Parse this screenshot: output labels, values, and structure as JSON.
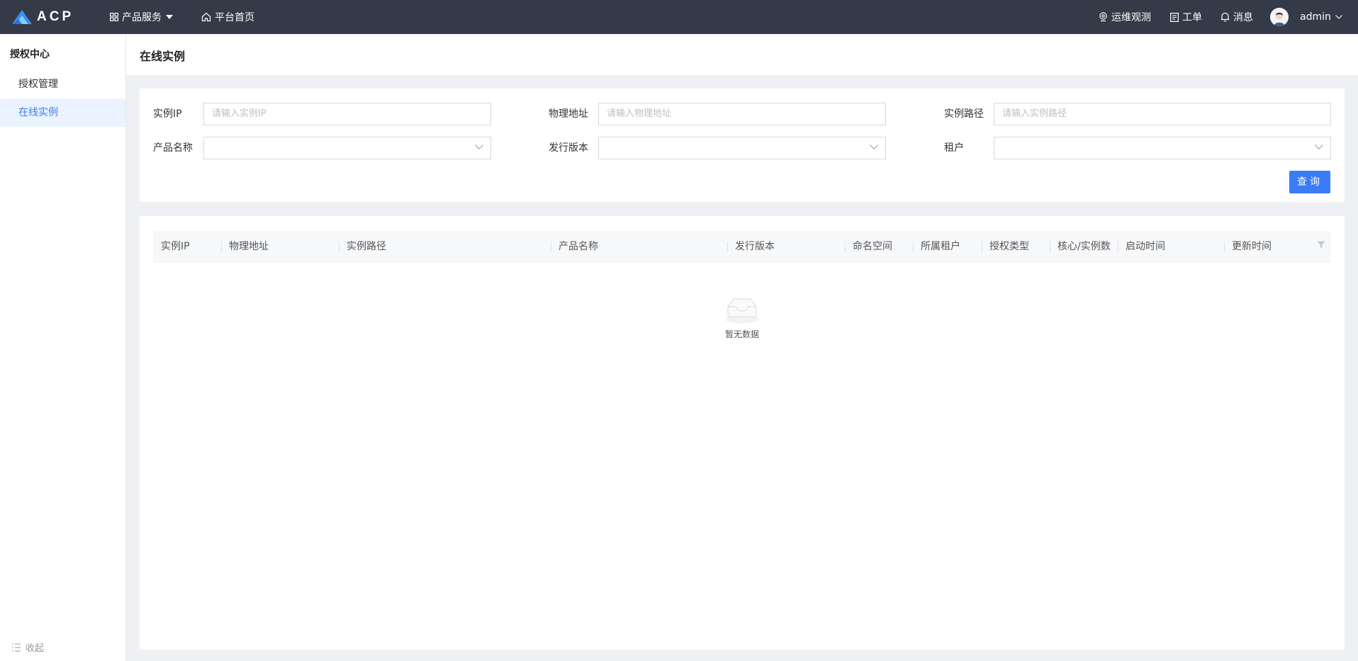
{
  "brand": {
    "name": "ACP"
  },
  "topnav": {
    "products": "产品服务",
    "home": "平台首页",
    "ops": "运维观测",
    "tickets": "工单",
    "messages": "消息",
    "user": "admin"
  },
  "sidebar": {
    "title": "授权中心",
    "items": [
      {
        "label": "授权管理"
      },
      {
        "label": "在线实例"
      }
    ],
    "collapse": "收起"
  },
  "page": {
    "title": "在线实例"
  },
  "filters": {
    "instance_ip": {
      "label": "实例IP",
      "placeholder": "请输入实例IP"
    },
    "physical_address": {
      "label": "物理地址",
      "placeholder": "请输入物理地址"
    },
    "instance_path": {
      "label": "实例路径",
      "placeholder": "请输入实例路径"
    },
    "product_name": {
      "label": "产品名称",
      "value": ""
    },
    "release_version": {
      "label": "发行版本",
      "value": ""
    },
    "tenant": {
      "label": "租户",
      "value": ""
    },
    "query_button": "查询"
  },
  "table": {
    "columns": [
      "实例IP",
      "物理地址",
      "实例路径",
      "产品名称",
      "发行版本",
      "命名空间",
      "所属租户",
      "授权类型",
      "核心/实例数",
      "启动时间",
      "更新时间"
    ],
    "rows": [],
    "empty_text": "暂无数据"
  },
  "colors": {
    "topbar": "#343a48",
    "accent": "#3a7cf5",
    "active_bg": "#eaf3ff"
  }
}
